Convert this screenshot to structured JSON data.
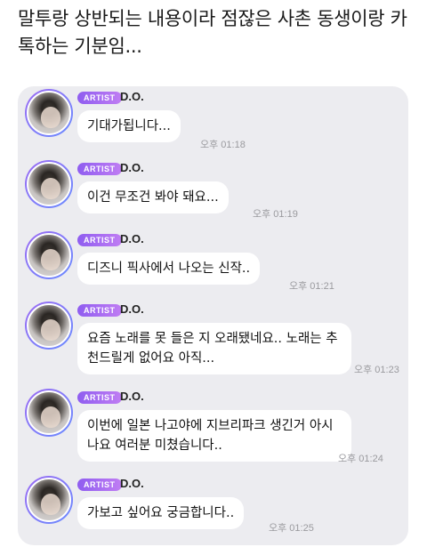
{
  "caption": "말투랑 상반되는 내용이라 점잖은 사촌 동생이랑 카톡하는 기분임...",
  "messages": [
    {
      "badge": "ARTIST",
      "sender": "D.O.",
      "text": "기대가됩니다...",
      "time": "오후 01:18"
    },
    {
      "badge": "ARTIST",
      "sender": "D.O.",
      "text": "이건 무조건 봐야 돼요...",
      "time": "오후 01:19"
    },
    {
      "badge": "ARTIST",
      "sender": "D.O.",
      "text": "디즈니 픽사에서 나오는 신작..",
      "time": "오후 01:21"
    },
    {
      "badge": "ARTIST",
      "sender": "D.O.",
      "text": "요즘 노래를 못 들은 지 오래됐네요.. 노래는 추천드릴게 없어요 아직...",
      "time": "오후 01:23"
    },
    {
      "badge": "ARTIST",
      "sender": "D.O.",
      "text": "이번에 일본 나고야에 지브리파크 생긴거 아시나요 여러분 미쳤습니다..",
      "time": "오후 01:24"
    },
    {
      "badge": "ARTIST",
      "sender": "D.O.",
      "text": "가보고 싶어요 궁금합니다..",
      "time": "오후 01:25"
    }
  ]
}
